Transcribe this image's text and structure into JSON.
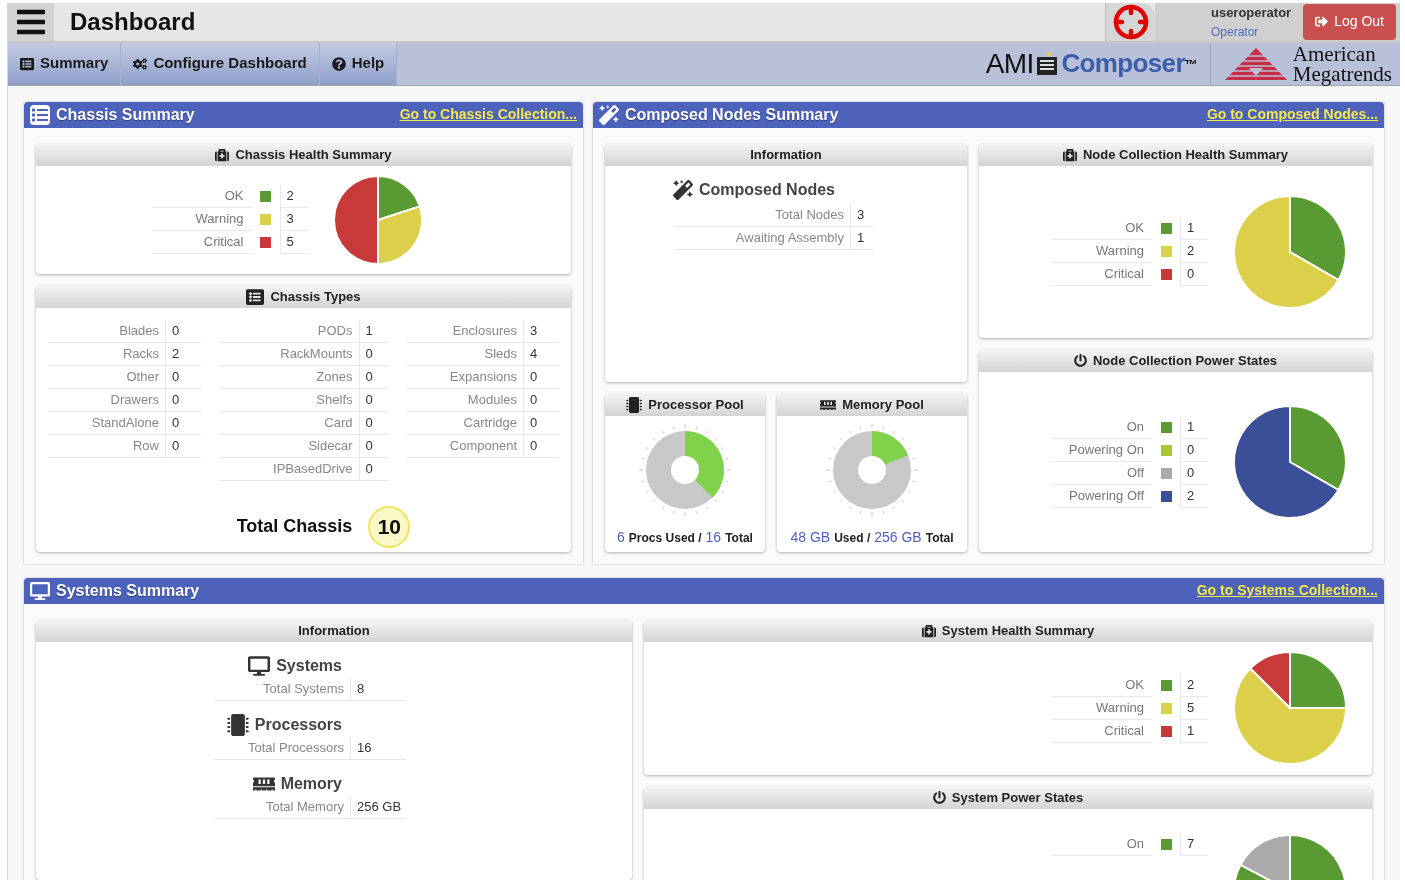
{
  "header": {
    "title": "Dashboard",
    "user": "useroperator",
    "role": "Operator",
    "logout": "Log Out"
  },
  "nav": [
    {
      "label": "Summary"
    },
    {
      "label": "Configure Dashboard"
    },
    {
      "label": "Help"
    }
  ],
  "logos": {
    "ami": "AMI",
    "product": "Composer",
    "tm": "™",
    "company_line1": "American",
    "company_line2": "Megatrends"
  },
  "chassis_summary": {
    "title": "Chassis Summary",
    "link": "Go to Chassis Collection...",
    "health": {
      "title": "Chassis Health Summary",
      "legend": [
        {
          "label": "OK",
          "value": "2",
          "color": "#5a9a32"
        },
        {
          "label": "Warning",
          "value": "3",
          "color": "#dccf4a"
        },
        {
          "label": "Critical",
          "value": "5",
          "color": "#c83a3a"
        }
      ]
    },
    "types": {
      "title": "Chassis Types",
      "columns": [
        [
          {
            "label": "Blades",
            "value": "0"
          },
          {
            "label": "Racks",
            "value": "2"
          },
          {
            "label": "Other",
            "value": "0"
          },
          {
            "label": "Drawers",
            "value": "0"
          },
          {
            "label": "StandAlone",
            "value": "0"
          },
          {
            "label": "Row",
            "value": "0"
          }
        ],
        [
          {
            "label": "PODs",
            "value": "1"
          },
          {
            "label": "RackMounts",
            "value": "0"
          },
          {
            "label": "Zones",
            "value": "0"
          },
          {
            "label": "Shelfs",
            "value": "0"
          },
          {
            "label": "Card",
            "value": "0"
          },
          {
            "label": "Sidecar",
            "value": "0"
          },
          {
            "label": "IPBasedDrive",
            "value": "0"
          }
        ],
        [
          {
            "label": "Enclosures",
            "value": "3"
          },
          {
            "label": "Sleds",
            "value": "4"
          },
          {
            "label": "Expansions",
            "value": "0"
          },
          {
            "label": "Modules",
            "value": "0"
          },
          {
            "label": "Cartridge",
            "value": "0"
          },
          {
            "label": "Component",
            "value": "0"
          }
        ]
      ]
    },
    "total": {
      "label": "Total Chassis",
      "value": "10"
    }
  },
  "composed_nodes": {
    "title": "Composed Nodes Summary",
    "link": "Go to Composed Nodes...",
    "information": {
      "title": "Information",
      "heading": "Composed Nodes",
      "rows": [
        {
          "label": "Total Nodes",
          "value": "3"
        },
        {
          "label": "Awaiting Assembly",
          "value": "1"
        }
      ]
    },
    "pools": [
      {
        "kind": "processor",
        "title": "Processor Pool",
        "used": "6",
        "used_label": "Procs Used /",
        "total": "16",
        "total_label": "Total"
      },
      {
        "kind": "memory",
        "title": "Memory Pool",
        "used": "48 GB",
        "used_label": "Used /",
        "total": "256 GB",
        "total_label": "Total"
      }
    ],
    "health": {
      "title": "Node Collection Health Summary",
      "legend": [
        {
          "label": "OK",
          "value": "1",
          "color": "#5a9a32"
        },
        {
          "label": "Warning",
          "value": "2",
          "color": "#dccf4a"
        },
        {
          "label": "Critical",
          "value": "0",
          "color": "#c83a3a"
        }
      ]
    },
    "power": {
      "title": "Node Collection Power States",
      "legend": [
        {
          "label": "On",
          "value": "1",
          "color": "#5a9a32"
        },
        {
          "label": "Powering On",
          "value": "0",
          "color": "#a8c63c"
        },
        {
          "label": "Off",
          "value": "0",
          "color": "#aaaaaa"
        },
        {
          "label": "Powering Off",
          "value": "2",
          "color": "#3a4f97"
        }
      ]
    }
  },
  "systems_summary": {
    "title": "Systems Summary",
    "link": "Go to Systems Collection...",
    "information": {
      "title": "Information",
      "groups": [
        {
          "kind": "systems",
          "heading": "Systems",
          "rows": [
            {
              "label": "Total Systems",
              "value": "8"
            }
          ]
        },
        {
          "kind": "processors",
          "heading": "Processors",
          "rows": [
            {
              "label": "Total Processors",
              "value": "16"
            }
          ]
        },
        {
          "kind": "memory",
          "heading": "Memory",
          "rows": [
            {
              "label": "Total Memory",
              "value": "256 GB"
            }
          ]
        }
      ]
    },
    "health": {
      "title": "System Health Summary",
      "legend": [
        {
          "label": "OK",
          "value": "2",
          "color": "#5a9a32"
        },
        {
          "label": "Warning",
          "value": "5",
          "color": "#dccf4a"
        },
        {
          "label": "Critical",
          "value": "1",
          "color": "#c83a3a"
        }
      ]
    },
    "power": {
      "title": "System Power States",
      "legend": [
        {
          "label": "On",
          "value": "7",
          "color": "#5a9a32"
        }
      ]
    }
  }
}
